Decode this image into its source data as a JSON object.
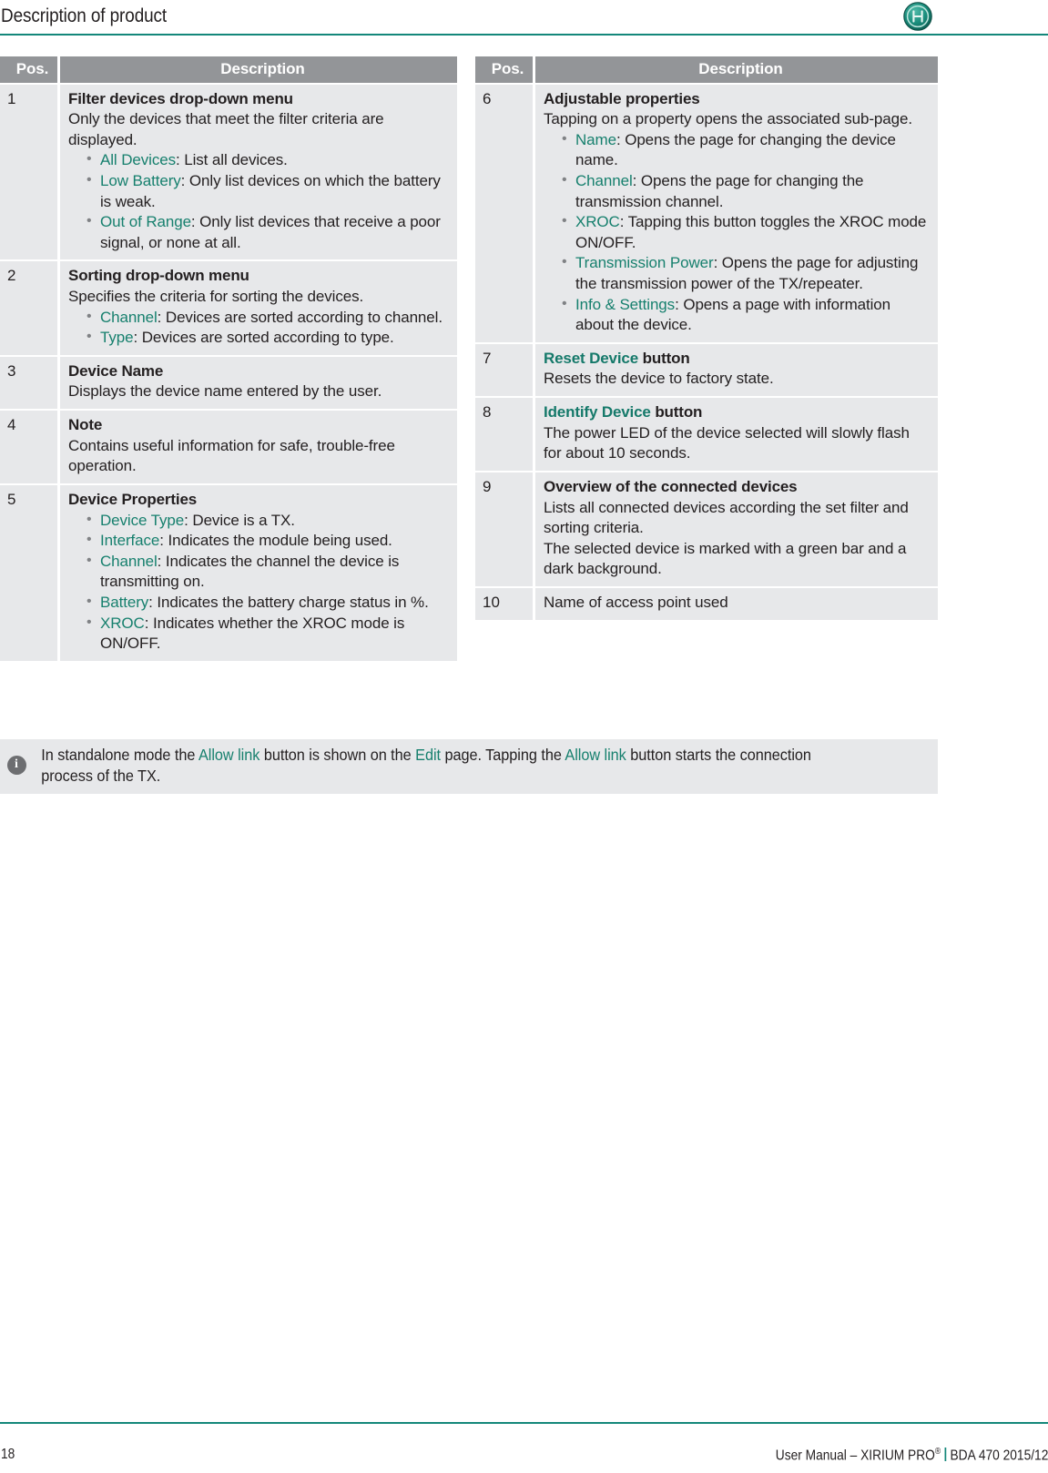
{
  "header": {
    "title": "Description of product",
    "logo_icon": "neutrik-circular-logo"
  },
  "colors": {
    "accent_teal": "#14877a",
    "link_green": "#17806e",
    "table_header_gray": "#939598",
    "table_cell_gray": "#e7e8ea",
    "text": "#231f20"
  },
  "tables": {
    "columns": {
      "pos": "Pos.",
      "description": "Description"
    },
    "left_rows": [
      {
        "pos": "1",
        "title": "Filter devices drop-down menu",
        "lines": [
          "Only the devices that meet the filter criteria are displayed."
        ],
        "bullets": [
          {
            "term": "All Devices",
            "text": ": List all devices."
          },
          {
            "term": "Low Battery",
            "text": ": Only list devices on which the battery is weak."
          },
          {
            "term": "Out of Range",
            "text": ": Only list devices that receive a poor signal, or none at all."
          }
        ]
      },
      {
        "pos": "2",
        "title": "Sorting drop-down menu",
        "lines": [
          "Specifies the criteria for sorting the devices."
        ],
        "bullets": [
          {
            "term": "Channel",
            "text": ": Devices are sorted according to channel."
          },
          {
            "term": "Type",
            "text": ": Devices are sorted according to type."
          }
        ]
      },
      {
        "pos": "3",
        "title": "Device Name",
        "lines": [
          "Displays the device name entered by the user."
        ],
        "bullets": []
      },
      {
        "pos": "4",
        "title": "Note",
        "lines": [
          "Contains useful information for safe, trouble-free operation."
        ],
        "bullets": []
      },
      {
        "pos": "5",
        "title": "Device Properties",
        "lines": [],
        "bullets": [
          {
            "term": "Device Type",
            "text": ": Device is a TX."
          },
          {
            "term": "Interface",
            "text": ": Indicates the module being used."
          },
          {
            "term": "Channel",
            "text": ": Indicates the channel the device is transmitting on."
          },
          {
            "term": "Battery",
            "text": ": Indicates the battery charge status in %."
          },
          {
            "term": "XROC",
            "text": ": Indicates whether the XROC mode is ON/OFF."
          }
        ]
      }
    ],
    "right_rows": [
      {
        "pos": "6",
        "title": "Adjustable properties",
        "lines": [
          "Tapping on a property opens the associated sub-page."
        ],
        "bullets": [
          {
            "term": "Name",
            "text": ": Opens the page for changing the device name."
          },
          {
            "term": "Channel",
            "text": ": Opens the page for changing the transmission channel."
          },
          {
            "term": "XROC",
            "text": ": Tapping this button toggles the XROC mode ON/OFF."
          },
          {
            "term": "Transmission Power",
            "text": ": Opens the page for adjusting the transmission power of the TX/repeater."
          },
          {
            "term": "Info & Settings",
            "text": ": Opens a page with information about the device."
          }
        ]
      },
      {
        "pos": "7",
        "title_green": "Reset Device",
        "title_rest": " button",
        "lines": [
          "Resets the device to factory state."
        ],
        "bullets": []
      },
      {
        "pos": "8",
        "title_green": "Identify Device",
        "title_rest": " button",
        "lines": [
          "The power LED of the device selected will slowly flash for about 10 seconds."
        ],
        "bullets": []
      },
      {
        "pos": "9",
        "title": "Overview of the connected devices",
        "lines": [
          "Lists all connected devices according the set filter and sorting criteria.",
          "The selected device is marked with a green bar and a dark background."
        ],
        "bullets": []
      },
      {
        "pos": "10",
        "plain": "Name of access point used",
        "lines": [],
        "bullets": []
      }
    ]
  },
  "note": {
    "icon": "info-icon",
    "segments": [
      {
        "t": "In standalone mode the ",
        "green": false
      },
      {
        "t": "Allow link",
        "green": true
      },
      {
        "t": " button is shown on the ",
        "green": false
      },
      {
        "t": "Edit",
        "green": true
      },
      {
        "t": " page. Tapping the ",
        "green": false
      },
      {
        "t": "Allow link",
        "green": true
      },
      {
        "t": " button starts the connection process of the TX.",
        "green": false
      }
    ]
  },
  "footer": {
    "page_number": "18",
    "manual_prefix": "User Manual – XIRIUM PRO",
    "registered_mark": "®",
    "doc_code": "BDA 470 2015/12"
  }
}
